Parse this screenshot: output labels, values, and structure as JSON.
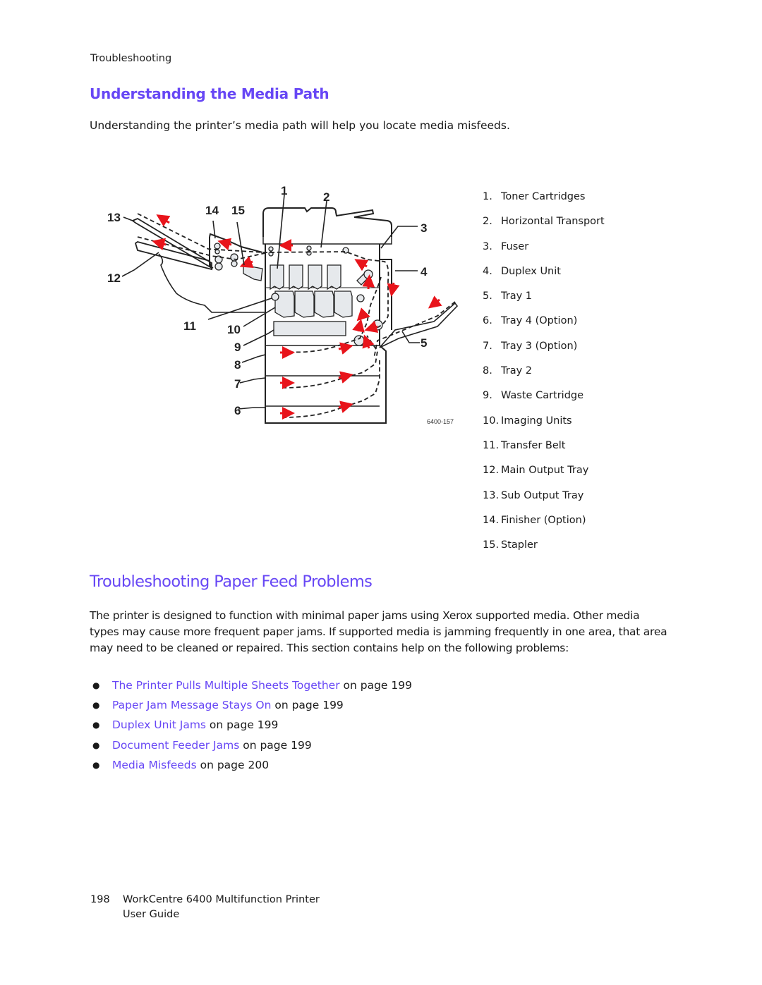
{
  "running_head": "Troubleshooting",
  "section": {
    "title": "Understanding the Media Path",
    "intro": "Understanding the printer’s media path will help you locate media misfeeds."
  },
  "figure": {
    "figure_id": "6400-157",
    "callout_numbers": [
      "1",
      "2",
      "3",
      "4",
      "5",
      "6",
      "7",
      "8",
      "9",
      "10",
      "11",
      "12",
      "13",
      "14",
      "15"
    ],
    "arrow_color": "#e8141b",
    "part_fill_color": "#e6e9ec",
    "callouts": [
      {
        "num": "1.",
        "label": "Toner Cartridges"
      },
      {
        "num": "2.",
        "label": "Horizontal Transport"
      },
      {
        "num": "3.",
        "label": "Fuser"
      },
      {
        "num": "4.",
        "label": "Duplex Unit"
      },
      {
        "num": "5.",
        "label": "Tray 1"
      },
      {
        "num": "6.",
        "label": "Tray 4 (Option)"
      },
      {
        "num": "7.",
        "label": "Tray 3 (Option)"
      },
      {
        "num": "8.",
        "label": "Tray 2"
      },
      {
        "num": "9.",
        "label": "Waste Cartridge"
      },
      {
        "num": "10.",
        "label": "Imaging Units"
      },
      {
        "num": "11.",
        "label": "Transfer Belt"
      },
      {
        "num": "12.",
        "label": "Main Output Tray"
      },
      {
        "num": "13.",
        "label": "Sub Output Tray"
      },
      {
        "num": "14.",
        "label": "Finisher (Option)"
      },
      {
        "num": "15.",
        "label": "Stapler"
      }
    ]
  },
  "feed_section": {
    "title": "Troubleshooting Paper Feed Problems",
    "paragraph": "The printer is designed to function with minimal paper jams using Xerox supported media. Other media types may cause more frequent paper jams. If supported media is jamming frequently in one area, that area may need to be cleaned or repaired. This section contains help on the following problems:",
    "bullet_glyph": "●",
    "links": [
      {
        "text": "The Printer Pulls Multiple Sheets Together",
        "suffix": " on page 199"
      },
      {
        "text": "Paper Jam Message Stays On",
        "suffix": " on page 199"
      },
      {
        "text": "Duplex Unit Jams",
        "suffix": " on page 199"
      },
      {
        "text": "Document Feeder Jams",
        "suffix": " on page 199"
      },
      {
        "text": "Media Misfeeds",
        "suffix": " on page 200"
      }
    ]
  },
  "footer": {
    "page_number": "198",
    "product": "WorkCentre 6400 Multifunction Printer",
    "guide": "User Guide"
  },
  "theme": {
    "heading_color": "#6747f5",
    "link_color": "#6747f5",
    "text_color": "#1a1a1a"
  }
}
